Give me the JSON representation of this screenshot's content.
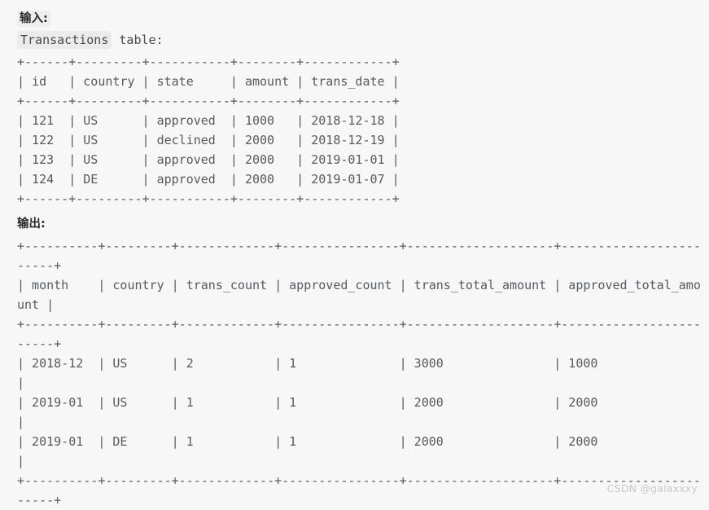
{
  "background_color": "#f7f7f7",
  "text_color": "#555a5f",
  "input_section": {
    "label": "输入:",
    "caption_code": "Transactions",
    "caption_rest": " table:",
    "ascii_table": "+------+---------+-----------+--------+------------+\n| id   | country | state     | amount | trans_date |\n+------+---------+-----------+--------+------------+\n| 121  | US      | approved  | 1000   | 2018-12-18 |\n| 122  | US      | declined  | 2000   | 2018-12-19 |\n| 123  | US      | approved  | 2000   | 2019-01-01 |\n| 124  | DE      | approved  | 2000   | 2019-01-07 |\n+------+---------+-----------+--------+------------+",
    "table_name": "Transactions",
    "columns": [
      "id",
      "country",
      "state",
      "amount",
      "trans_date"
    ],
    "rows": [
      [
        "121",
        "US",
        "approved",
        "1000",
        "2018-12-18"
      ],
      [
        "122",
        "US",
        "declined",
        "2000",
        "2018-12-19"
      ],
      [
        "123",
        "US",
        "approved",
        "2000",
        "2019-01-01"
      ],
      [
        "124",
        "DE",
        "approved",
        "2000",
        "2019-01-07"
      ]
    ]
  },
  "output_section": {
    "label": "输出:",
    "ascii_table": "+----------+---------+-------------+----------------+--------------------+------------------------+\n| month    | country | trans_count | approved_count | trans_total_amount | approved_total_amount |\n+----------+---------+-------------+----------------+--------------------+------------------------+\n| 2018-12  | US      | 2           | 1              | 3000               | 1000                  |\n| 2019-01  | US      | 1           | 1              | 2000               | 2000                  |\n| 2019-01  | DE      | 1           | 1              | 2000               | 2000                  |\n+----------+---------+-------------+----------------+--------------------+------------------------+",
    "columns": [
      "month",
      "country",
      "trans_count",
      "approved_count",
      "trans_total_amount",
      "approved_total_amount"
    ],
    "rows": [
      [
        "2018-12",
        "US",
        "2",
        "1",
        "3000",
        "1000"
      ],
      [
        "2019-01",
        "US",
        "1",
        "1",
        "2000",
        "2000"
      ],
      [
        "2019-01",
        "DE",
        "1",
        "1",
        "2000",
        "2000"
      ]
    ]
  },
  "watermark": {
    "text": "CSDN @galaxxxy",
    "color": "#c9c9c9"
  }
}
